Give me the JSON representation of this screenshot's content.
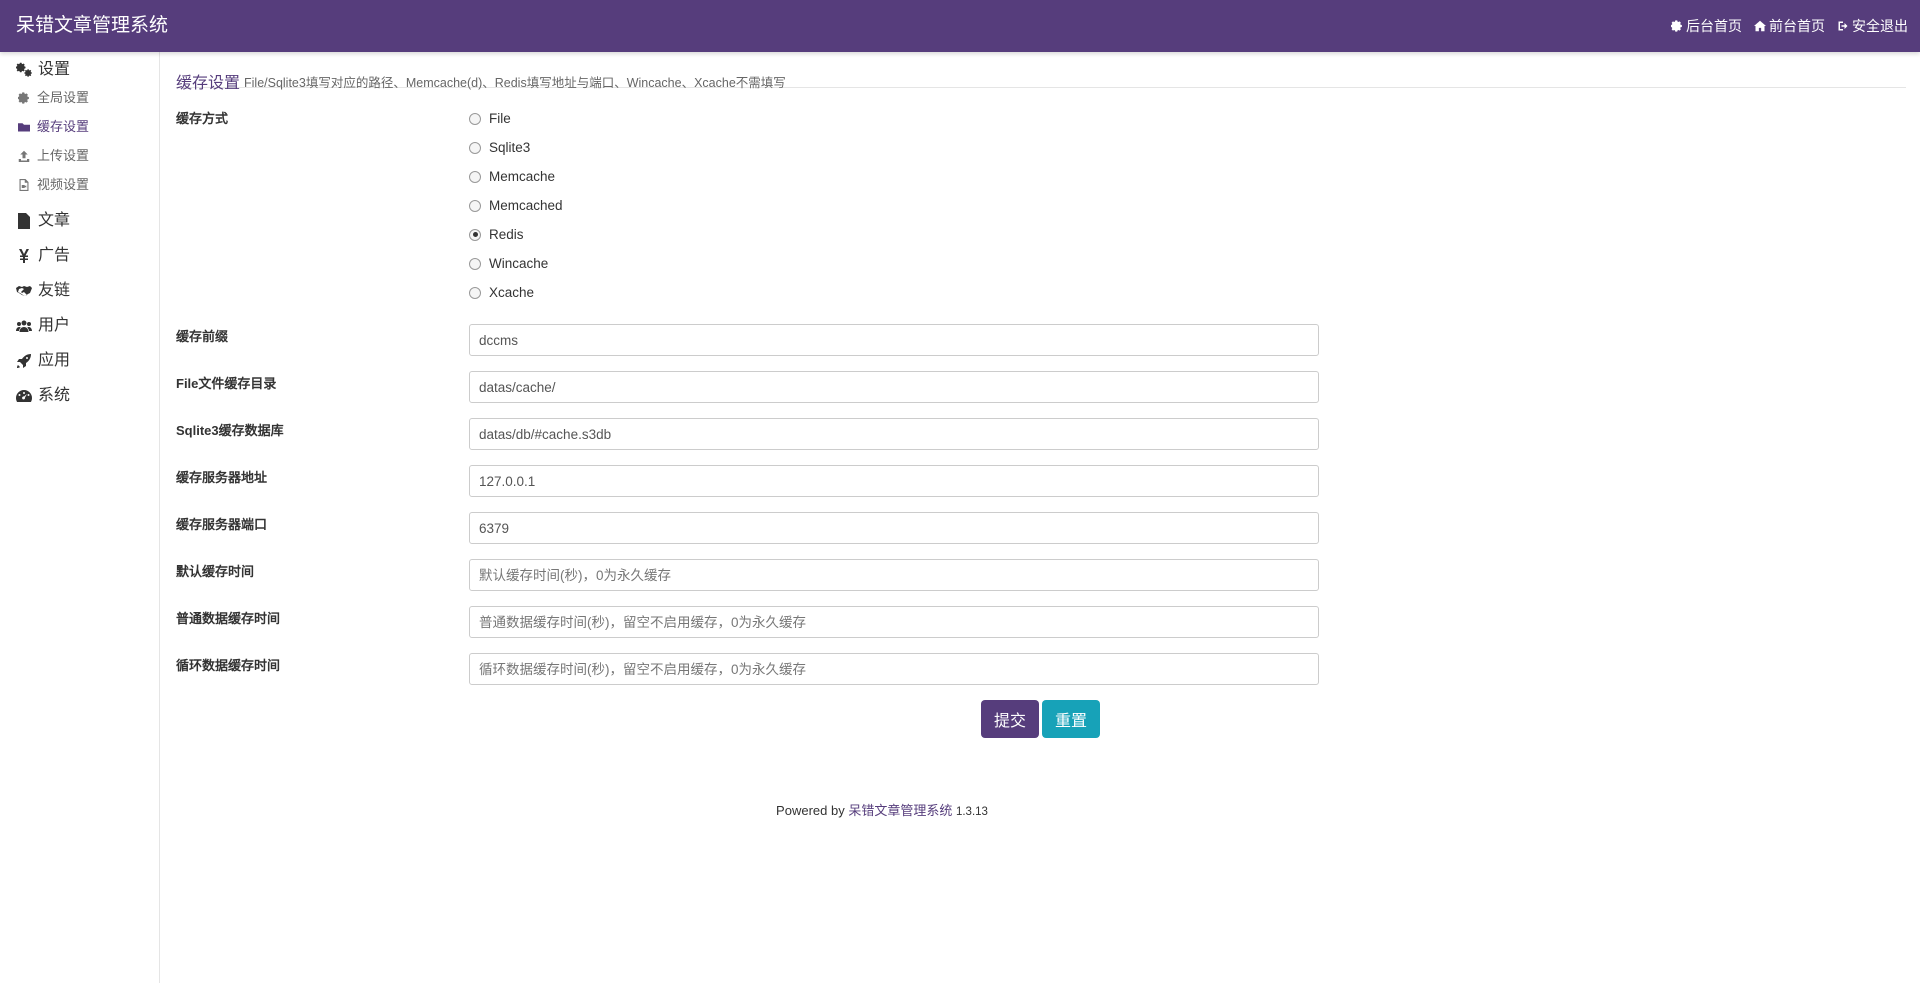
{
  "header": {
    "brand": "呆错文章管理系统",
    "links": [
      {
        "label": "后台首页",
        "icon": "gear-icon"
      },
      {
        "label": "前台首页",
        "icon": "home-icon"
      },
      {
        "label": "安全退出",
        "icon": "logout-icon"
      }
    ]
  },
  "sidebar": {
    "settings_label": "设置",
    "settings_items": [
      {
        "label": "全局设置",
        "icon": "gear-icon"
      },
      {
        "label": "缓存设置",
        "icon": "folder-icon",
        "active": true
      },
      {
        "label": "上传设置",
        "icon": "upload-icon"
      },
      {
        "label": "视频设置",
        "icon": "video-file-icon"
      }
    ],
    "groups": [
      {
        "label": "文章",
        "icon": "file-icon"
      },
      {
        "label": "广告",
        "icon": "yen-icon"
      },
      {
        "label": "友链",
        "icon": "handshake-icon"
      },
      {
        "label": "用户",
        "icon": "users-icon"
      },
      {
        "label": "应用",
        "icon": "rocket-icon"
      },
      {
        "label": "系统",
        "icon": "dashboard-icon"
      }
    ]
  },
  "page": {
    "title": "缓存设置",
    "hint": "File/Sqlite3填写对应的路径、Memcache(d)、Redis填写地址与端口、Wincache、Xcache不需填写"
  },
  "form": {
    "cache_type_label": "缓存方式",
    "cache_type_options": [
      "File",
      "Sqlite3",
      "Memcache",
      "Memcached",
      "Redis",
      "Wincache",
      "Xcache"
    ],
    "cache_type_selected": "Redis",
    "fields": [
      {
        "label": "缓存前缀",
        "value": "dccms",
        "placeholder": ""
      },
      {
        "label": "File文件缓存目录",
        "value": "datas/cache/",
        "placeholder": ""
      },
      {
        "label": "Sqlite3缓存数据库",
        "value": "datas/db/#cache.s3db",
        "placeholder": ""
      },
      {
        "label": "缓存服务器地址",
        "value": "127.0.0.1",
        "placeholder": ""
      },
      {
        "label": "缓存服务器端口",
        "value": "6379",
        "placeholder": ""
      },
      {
        "label": "默认缓存时间",
        "value": "",
        "placeholder": "默认缓存时间(秒)，0为永久缓存"
      },
      {
        "label": "普通数据缓存时间",
        "value": "",
        "placeholder": "普通数据缓存时间(秒)，留空不启用缓存，0为永久缓存"
      },
      {
        "label": "循环数据缓存时间",
        "value": "",
        "placeholder": "循环数据缓存时间(秒)，留空不启用缓存，0为永久缓存"
      }
    ],
    "submit_label": "提交",
    "reset_label": "重置"
  },
  "footer": {
    "prefix": "Powered by",
    "link": "呆错文章管理系统",
    "version": "1.3.13"
  },
  "colors": {
    "primary": "#563d7c",
    "reset_button": "#17a2b8"
  }
}
